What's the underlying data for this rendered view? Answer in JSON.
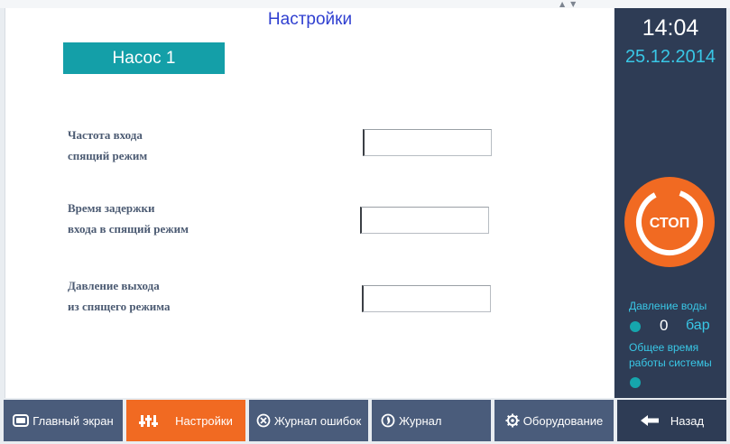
{
  "page": {
    "title": "Настройки"
  },
  "pump": {
    "label": "Насос 1"
  },
  "params": [
    {
      "line1": "Частота входа",
      "line2": "спящий режим",
      "value": ""
    },
    {
      "line1": "Время задержки",
      "line2": "входа в спящий режим",
      "value": ""
    },
    {
      "line1": "Давление выхода",
      "line2": "из спящего режима",
      "value": ""
    }
  ],
  "status": {
    "time": "14:04",
    "date": "25.12.2014",
    "stop_label": "СТОП",
    "pressure_label": "Давление воды",
    "pressure_value": "0",
    "pressure_unit": "бар",
    "runtime_label_1": "Общее время",
    "runtime_label_2": "работы системы"
  },
  "nav": {
    "main_screen": "Главный экран",
    "settings": "Настройки",
    "error_log": "Журнал ошибок",
    "log": "Журнал",
    "equipment": "Оборудование",
    "back": "Назад"
  },
  "colors": {
    "accent_orange": "#f16a22",
    "teal": "#149fa8",
    "panel_dark": "#2e3c55",
    "nav_blue": "#4a5c7b",
    "title_blue": "#2f3fd0",
    "info_cyan": "#39c7e6"
  },
  "icons": {
    "main_screen": "monitor-icon",
    "settings": "sliders-icon",
    "error_log": "error-circle-icon",
    "log": "journal-icon",
    "equipment": "gear-icon",
    "back": "arrow-left-icon"
  }
}
